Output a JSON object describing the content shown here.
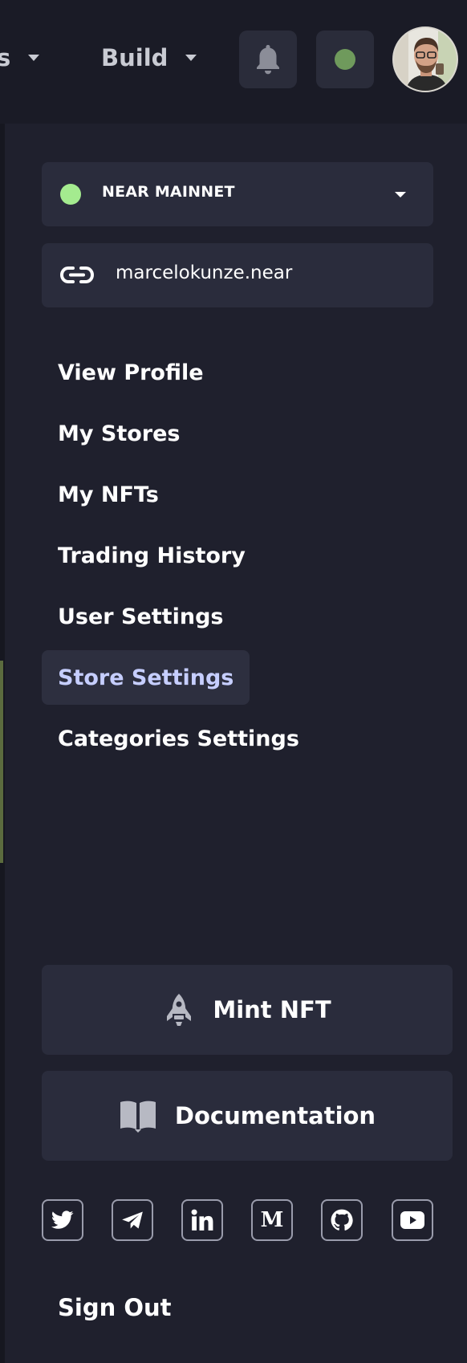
{
  "nav": {
    "services_label": "s",
    "build_label": "Build"
  },
  "status": {
    "dot_color": "#6f9a5c"
  },
  "network": {
    "label": "NEAR MAINNET",
    "dot_color": "#a4eb8f"
  },
  "account": {
    "name": "marcelokunze.near"
  },
  "menu": {
    "items": [
      {
        "label": "View Profile"
      },
      {
        "label": "My Stores"
      },
      {
        "label": "My NFTs"
      },
      {
        "label": "Trading History"
      },
      {
        "label": "User Settings"
      },
      {
        "label": "Store Settings",
        "active": true
      },
      {
        "label": "Categories Settings"
      }
    ]
  },
  "actions": {
    "mint_label": "Mint NFT",
    "docs_label": "Documentation"
  },
  "social": {
    "icons": [
      "twitter-icon",
      "telegram-icon",
      "linkedin-icon",
      "medium-icon",
      "github-icon",
      "youtube-icon"
    ],
    "medium_glyph": "M"
  },
  "sign_out_label": "Sign Out",
  "colors": {
    "background": "#1f202d",
    "topbar": "#1a1b26",
    "card": "#2a2c3c",
    "active_text": "#c6ceff"
  }
}
